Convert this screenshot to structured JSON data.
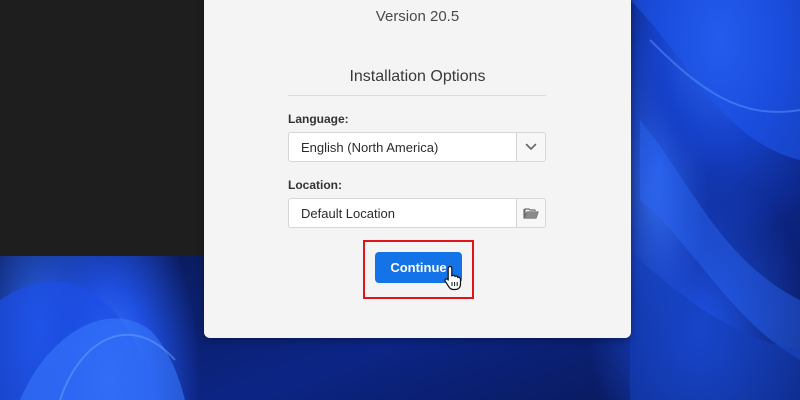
{
  "dialog": {
    "version": "Version 20.5",
    "section_title": "Installation Options"
  },
  "language": {
    "label": "Language:",
    "value": "English (North America)",
    "dropdown_icon": "chevron-down-icon"
  },
  "location": {
    "label": "Location:",
    "value": "Default Location",
    "browse_icon": "folder-icon"
  },
  "actions": {
    "continue_label": "Continue",
    "highlight_color": "#e0141b",
    "button_color": "#1473e6"
  },
  "cursor": {
    "icon": "hand-pointer-icon"
  }
}
